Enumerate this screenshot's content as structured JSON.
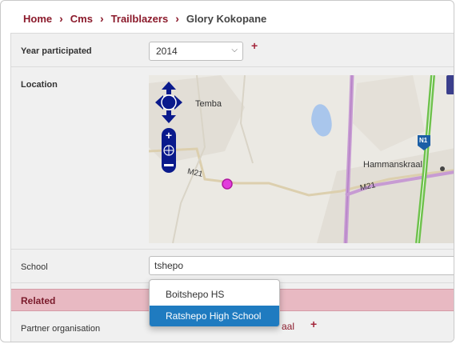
{
  "breadcrumb": {
    "items": [
      "Home",
      "Cms",
      "Trailblazers"
    ],
    "current": "Glory Kokopane"
  },
  "form": {
    "year": {
      "label": "Year participated",
      "value": "2014"
    },
    "location": {
      "label": "Location",
      "map_labels": {
        "town1": "Temba",
        "town2": "Hammanskraal",
        "road1": "M21",
        "road2": "M21",
        "shield": "N1"
      }
    },
    "school": {
      "label": "School",
      "value": "tshepo"
    },
    "related": {
      "title": "Related"
    },
    "partner": {
      "label": "Partner organisation",
      "link_text": "aal"
    }
  },
  "dropdown": {
    "options": [
      "Boitshepo HS",
      "Ratshepo High School"
    ],
    "active_index": 1
  },
  "colors": {
    "brand": "#8b1a2b",
    "selected": "#1f7bc0",
    "section": "#e8b9c2"
  }
}
